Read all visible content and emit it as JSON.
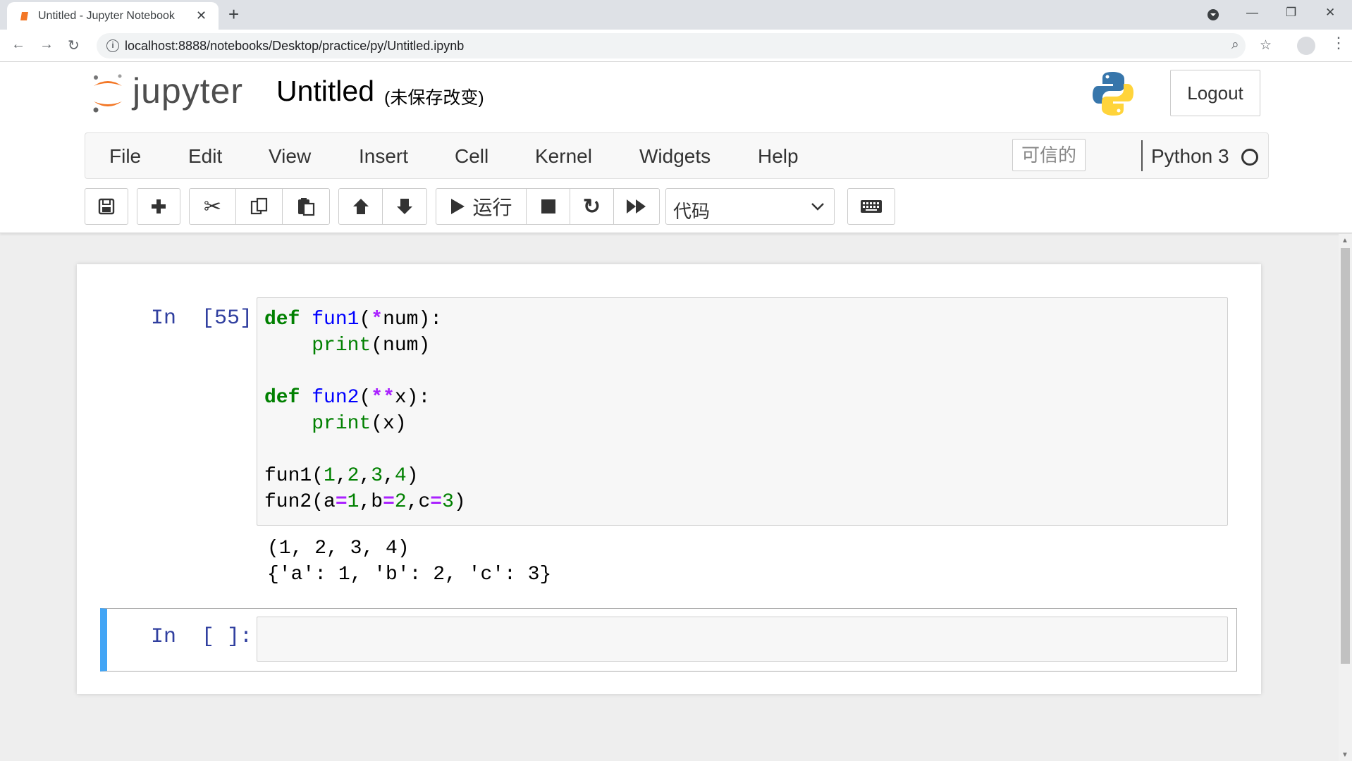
{
  "browser": {
    "tab_title": "Untitled - Jupyter Notebook",
    "url": "localhost:8888/notebooks/Desktop/practice/py/Untitled.ipynb"
  },
  "header": {
    "logo_text": "jupyter",
    "notebook_name": "Untitled",
    "save_status": "(未保存改变)",
    "logout_label": "Logout"
  },
  "menubar": {
    "items": [
      "File",
      "Edit",
      "View",
      "Insert",
      "Cell",
      "Kernel",
      "Widgets",
      "Help"
    ],
    "trusted_label": "可信的",
    "kernel_name": "Python 3"
  },
  "toolbar": {
    "run_label": "运行",
    "cell_type": "代码"
  },
  "cells": [
    {
      "prompt": "In  [55]:",
      "code_lines": [
        "def fun1(*num):",
        "    print(num)",
        "",
        "def fun2(**x):",
        "    print(x)",
        "",
        "fun1(1,2,3,4)",
        "fun2(a=1,b=2,c=3)"
      ],
      "output_lines": [
        "(1, 2, 3, 4)",
        "{'a': 1, 'b': 2, 'c': 3}"
      ]
    },
    {
      "prompt": "In  [ ]:",
      "code_lines": []
    }
  ],
  "colors": {
    "prompt": "#303f9f",
    "keyword": "#008000",
    "function": "#0000ff",
    "operator": "#aa22ff",
    "selected_cell_border": "#42a5f5"
  }
}
